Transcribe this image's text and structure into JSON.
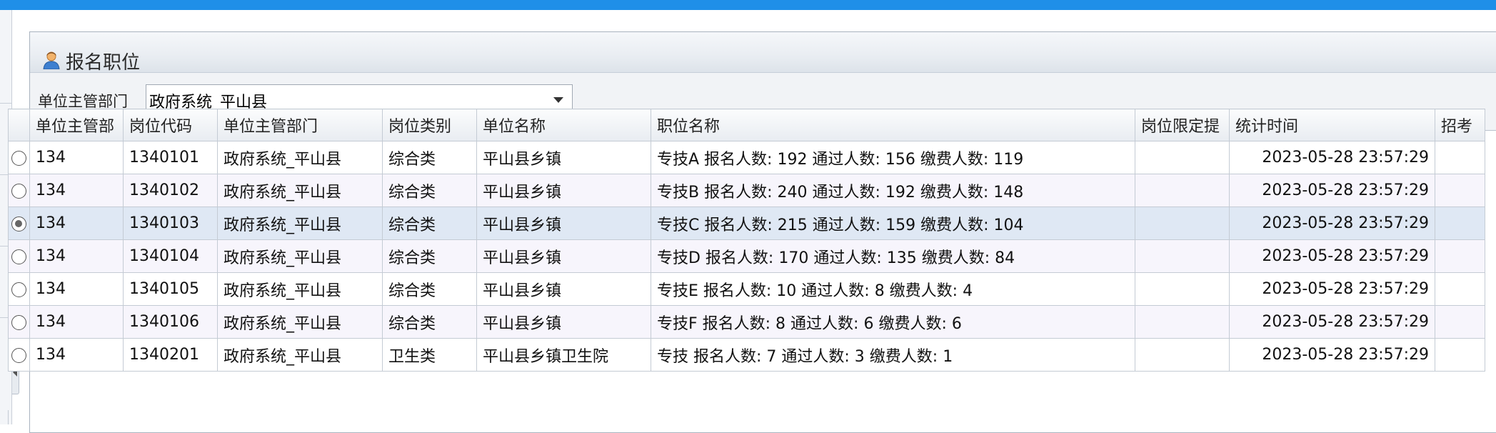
{
  "panel": {
    "title": "报名职位",
    "icon": "user-icon"
  },
  "filter": {
    "label": "单位主管部门",
    "selected": "政府系统_平山县"
  },
  "columns": [
    "",
    "单位主管部",
    "岗位代码",
    "单位主管部门",
    "岗位类别",
    "单位名称",
    "职位名称",
    "岗位限定提",
    "统计时间",
    "招考"
  ],
  "rows": [
    {
      "checked": false,
      "dept_code": "134",
      "post_code": "1340101",
      "dept": "政府系统_平山县",
      "category": "综合类",
      "unit": "平山县乡镇",
      "position": "专技A 报名人数: 192 通过人数: 156 缴费人数: 119",
      "limit": "",
      "time": "2023-05-28 23:57:29",
      "extra": ""
    },
    {
      "checked": false,
      "dept_code": "134",
      "post_code": "1340102",
      "dept": "政府系统_平山县",
      "category": "综合类",
      "unit": "平山县乡镇",
      "position": "专技B 报名人数: 240 通过人数: 192 缴费人数: 148",
      "limit": "",
      "time": "2023-05-28 23:57:29",
      "extra": ""
    },
    {
      "checked": true,
      "dept_code": "134",
      "post_code": "1340103",
      "dept": "政府系统_平山县",
      "category": "综合类",
      "unit": "平山县乡镇",
      "position": "专技C 报名人数: 215 通过人数: 159 缴费人数: 104",
      "limit": "",
      "time": "2023-05-28 23:57:29",
      "extra": ""
    },
    {
      "checked": false,
      "dept_code": "134",
      "post_code": "1340104",
      "dept": "政府系统_平山县",
      "category": "综合类",
      "unit": "平山县乡镇",
      "position": "专技D 报名人数: 170 通过人数: 135 缴费人数: 84",
      "limit": "",
      "time": "2023-05-28 23:57:29",
      "extra": ""
    },
    {
      "checked": false,
      "dept_code": "134",
      "post_code": "1340105",
      "dept": "政府系统_平山县",
      "category": "综合类",
      "unit": "平山县乡镇",
      "position": "专技E 报名人数: 10 通过人数: 8 缴费人数: 4",
      "limit": "",
      "time": "2023-05-28 23:57:29",
      "extra": ""
    },
    {
      "checked": false,
      "dept_code": "134",
      "post_code": "1340106",
      "dept": "政府系统_平山县",
      "category": "综合类",
      "unit": "平山县乡镇",
      "position": "专技F 报名人数: 8 通过人数: 6 缴费人数: 6",
      "limit": "",
      "time": "2023-05-28 23:57:29",
      "extra": ""
    },
    {
      "checked": false,
      "dept_code": "134",
      "post_code": "1340201",
      "dept": "政府系统_平山县",
      "category": "卫生类",
      "unit": "平山县乡镇卫生院",
      "position": "专技 报名人数: 7 通过人数: 3 缴费人数: 1",
      "limit": "",
      "time": "2023-05-28 23:57:29",
      "extra": ""
    }
  ],
  "colors": {
    "top_bar": "#1f8fe8",
    "selected_row": "#dfe8f4",
    "alt_row": "#f7f5fc"
  }
}
